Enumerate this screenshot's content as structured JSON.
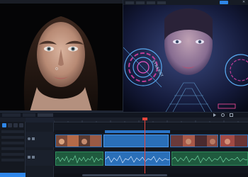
{
  "colors": {
    "accent": "#2f86e8",
    "playhead": "#e8453c",
    "video_track": "#2a6fb8",
    "audio_track": "#2d8b5b",
    "panel_bg": "#141820",
    "window_bg": "#0b0d12"
  },
  "icons": {
    "left_tools": [
      "pointer-icon",
      "hand-icon",
      "zoom-icon",
      "crop-icon",
      "transform-icon"
    ],
    "right_toolbar": [
      "play-icon",
      "settings-icon",
      "expand-icon"
    ],
    "track_toggles": [
      "eye-icon",
      "lock-icon",
      "speaker-icon",
      "mute-icon"
    ]
  },
  "viewer": {
    "right_tabs": [
      "",
      "",
      "",
      ""
    ],
    "left_timecode": "",
    "right_timecode": "",
    "hud_text": "SYNERGY",
    "hud_secondary": ""
  },
  "timeline": {
    "tabs": [
      "",
      "",
      ""
    ],
    "sequence_name": "",
    "ruler_labels": [
      "",
      "",
      "",
      "",
      "",
      ""
    ],
    "video_clip_labels": [
      "",
      "",
      "",
      ""
    ],
    "audio_clip_labels": [
      "",
      "",
      ""
    ],
    "track_names": [
      "",
      "",
      "",
      "",
      ""
    ]
  }
}
